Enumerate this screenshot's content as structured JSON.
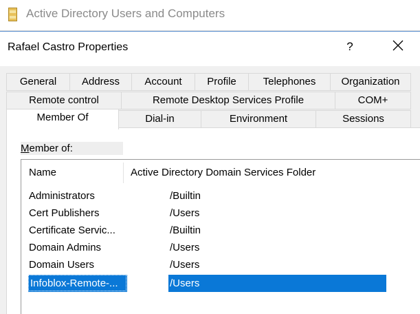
{
  "app": {
    "title": "Active Directory Users and Computers",
    "icon": "folder-icon"
  },
  "dialog": {
    "title": "Rafael Castro Properties",
    "help_label": "?",
    "close_icon": "close-icon"
  },
  "tabs": {
    "row1": [
      "General",
      "Address",
      "Account",
      "Profile",
      "Telephones",
      "Organization"
    ],
    "row2": [
      "Remote control",
      "Remote Desktop Services Profile",
      "COM+"
    ],
    "row3": [
      "Member Of",
      "Dial-in",
      "Environment",
      "Sessions"
    ],
    "active": "Member Of"
  },
  "member_of": {
    "label": "Member of:",
    "label_mnemonic": "M",
    "label_rest": "ember of:",
    "columns": [
      "Name",
      "Active Directory Domain Services Folder"
    ],
    "rows": [
      {
        "name": "Administrators",
        "folder": "/Builtin",
        "selected": false
      },
      {
        "name": "Cert Publishers",
        "folder": "/Users",
        "selected": false
      },
      {
        "name": "Certificate Servic...",
        "folder": "/Builtin",
        "selected": false
      },
      {
        "name": "Domain Admins",
        "folder": "/Users",
        "selected": false
      },
      {
        "name": "Domain Users",
        "folder": "/Users",
        "selected": false
      },
      {
        "name": "Infoblox-Remote-...",
        "folder": "/Users",
        "selected": true
      }
    ]
  },
  "colors": {
    "accent": "#0a78d7",
    "title_text": "#8a8a8a",
    "dialog_border": "#5a8fd0",
    "client_bg": "#f0f0f0"
  }
}
